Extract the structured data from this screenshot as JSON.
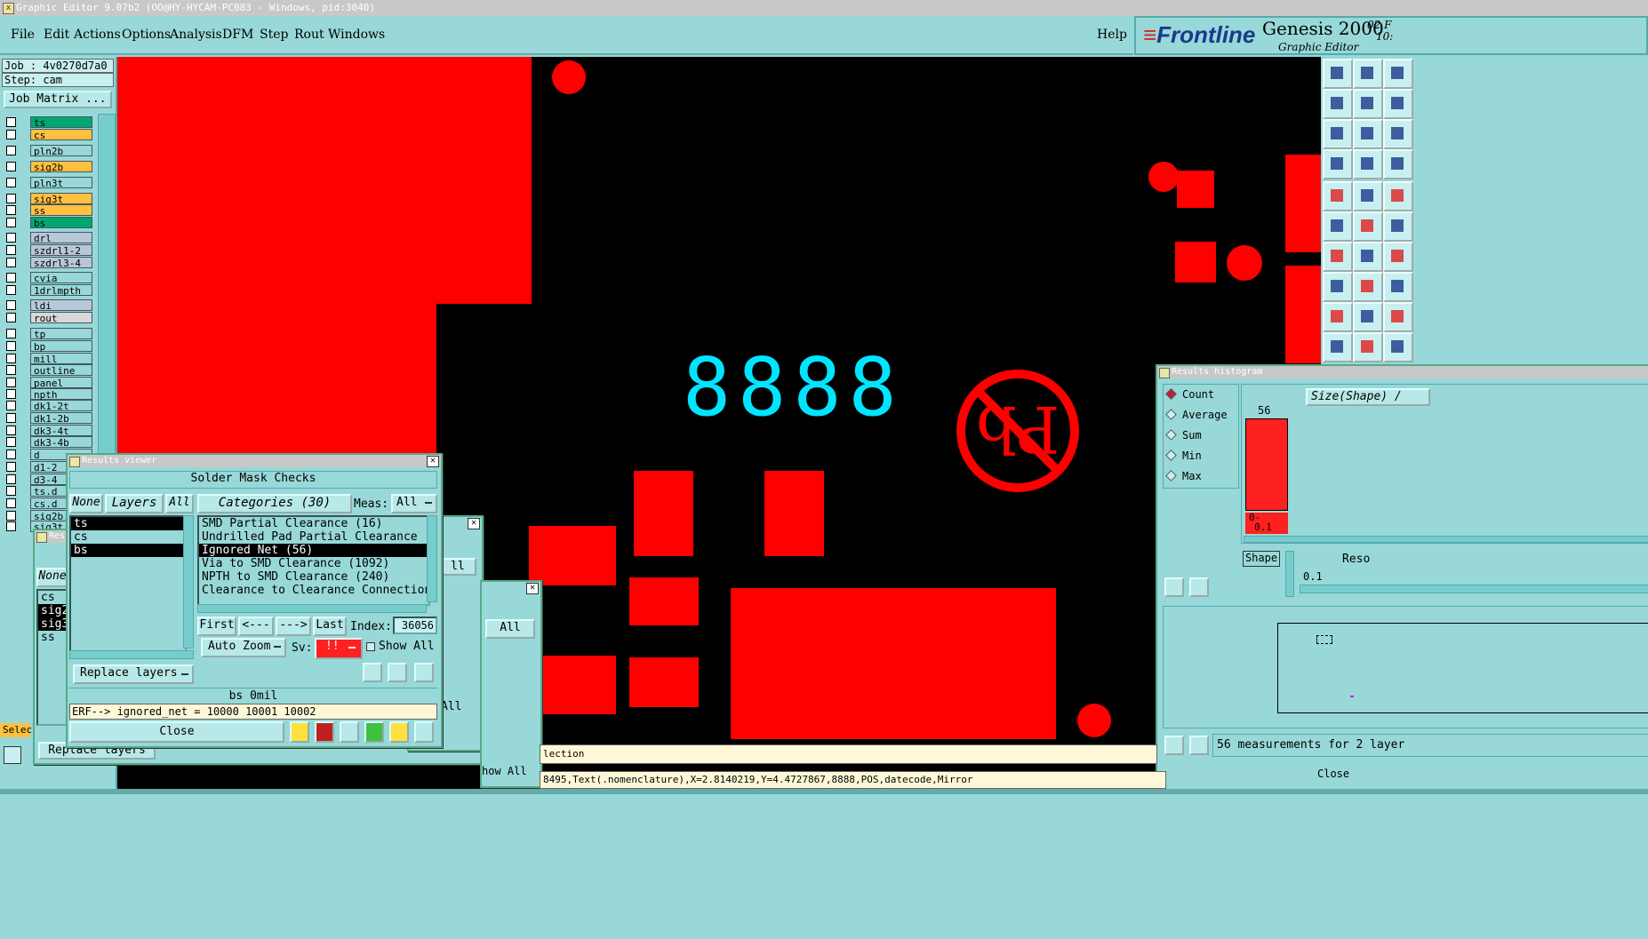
{
  "app": {
    "window_title": "Graphic Editor 9.07b2 (OO@HY-HYCAM-PC083 - Windows, pid:3040)",
    "menu": [
      "File",
      "Edit",
      "Actions",
      "Options",
      "Analysis",
      "DFM",
      "Step",
      "Rout",
      "Windows"
    ],
    "help": "Help",
    "brand_logo": "Frontline",
    "brand_name": "Genesis 2000",
    "brand_sub": "Graphic Editor",
    "brand_date": "02 F",
    "brand_time": "10:"
  },
  "job": {
    "job_line": "Job : 4v0270d7a0",
    "step_line": "Step: cam",
    "job_matrix_button": "Job Matrix ..."
  },
  "layers": [
    {
      "name": "ts",
      "color": "#00a870"
    },
    {
      "name": "cs",
      "color": "#ffc040"
    },
    {
      "name": "pln2b",
      "color": "#98d8d8"
    },
    {
      "name": "sig2b",
      "color": "#ffc040"
    },
    {
      "name": "pln3t",
      "color": "#98d8d8"
    },
    {
      "name": "sig3t",
      "color": "#ffc040"
    },
    {
      "name": "ss",
      "color": "#ffc040"
    },
    {
      "name": "bs",
      "color": "#00a870"
    },
    {
      "name": "drl",
      "color": "#b8c8d8"
    },
    {
      "name": "szdrl1-2",
      "color": "#b8c8d8"
    },
    {
      "name": "szdrl3-4",
      "color": "#b8c8d8"
    },
    {
      "name": "cvia",
      "color": "#98d8d8"
    },
    {
      "name": "1drlmpth",
      "color": "#98d8d8"
    },
    {
      "name": "ldi",
      "color": "#b8c8d8"
    },
    {
      "name": "rout",
      "color": "#d8d8d8"
    },
    {
      "name": "tp",
      "color": "#98d8d8"
    },
    {
      "name": "bp",
      "color": "#98d8d8"
    },
    {
      "name": "mill",
      "color": "#98d8d8"
    },
    {
      "name": "outline",
      "color": "#98d8d8"
    },
    {
      "name": "panel",
      "color": "#98d8d8"
    },
    {
      "name": "npth",
      "color": "#98d8d8"
    },
    {
      "name": "dk1-2t",
      "color": "#98d8d8"
    },
    {
      "name": "dk1-2b",
      "color": "#98d8d8"
    },
    {
      "name": "dk3-4t",
      "color": "#98d8d8"
    },
    {
      "name": "dk3-4b",
      "color": "#98d8d8"
    },
    {
      "name": "d",
      "color": "#98d8d8"
    },
    {
      "name": "d1-2",
      "color": "#98d8d8"
    },
    {
      "name": "d3-4",
      "color": "#98d8d8"
    },
    {
      "name": "ts.d",
      "color": "#98d8d8"
    },
    {
      "name": "cs.d",
      "color": "#98d8d8"
    },
    {
      "name": "sig2b.",
      "color": "#98d8d8"
    },
    {
      "name": "sig3t.",
      "color": "#98d8d8"
    }
  ],
  "canvas": {
    "display_text": "8888",
    "status_line": "8495,Text(.nomenclature),X=2.8140219,Y=4.4727867,8888,POS,datecode,Mirror",
    "selection_fragment": "lection",
    "select_fragment": "Selec"
  },
  "results_viewer": {
    "title": "Results viewer",
    "header": "Solder Mask Checks",
    "none_btn": "None",
    "layers_btn": "Layers",
    "all_btn": "All",
    "categories_btn": "Categories (30)",
    "meas_label": "Meas:",
    "meas_value": "All",
    "layer_list": [
      "ts",
      "cs",
      "bs"
    ],
    "categories": [
      "SMD Partial Clearance (16)",
      "Undrilled Pad Partial Clearance (",
      "Ignored Net (56)",
      "Via to SMD Clearance (1092)",
      "NPTH to SMD Clearance (240)",
      "Clearance to Clearance Connection"
    ],
    "first": "First",
    "prev": "<---",
    "next": "--->",
    "last": "Last",
    "index_label": "Index:",
    "index_value": "36056",
    "auto_zoom": "Auto Zoom",
    "sv_label": "Sv:",
    "sv_value": "!!",
    "show_all": "Show All",
    "replace_layers": "Replace layers",
    "footer_title": "bs 0mil",
    "erf_line": "ERF--> ignored_net = 10000 10001 10002",
    "close": "Close"
  },
  "background_window": {
    "title_fragment": "Res",
    "none_btn": "None",
    "layers": [
      "cs",
      "sig2",
      "sig3",
      "ss"
    ],
    "replace_layers": "Replace layers",
    "all_fragment": "ll",
    "all_btn": "All",
    "all_fragment2": "All",
    "show_all": "how All"
  },
  "histogram": {
    "title": "Results histogram",
    "modes": [
      "Count",
      "Average",
      "Sum",
      "Min",
      "Max"
    ],
    "size_shape": "Size(Shape) /",
    "bar_value": "56",
    "bar_label_1": "0-",
    "bar_label_2": "0.1",
    "shape_btn": "Shape",
    "reso_label": "Reso",
    "reso_value": "0.1",
    "summary": "56 measurements for 2 layer",
    "close_fragment": "Close"
  }
}
